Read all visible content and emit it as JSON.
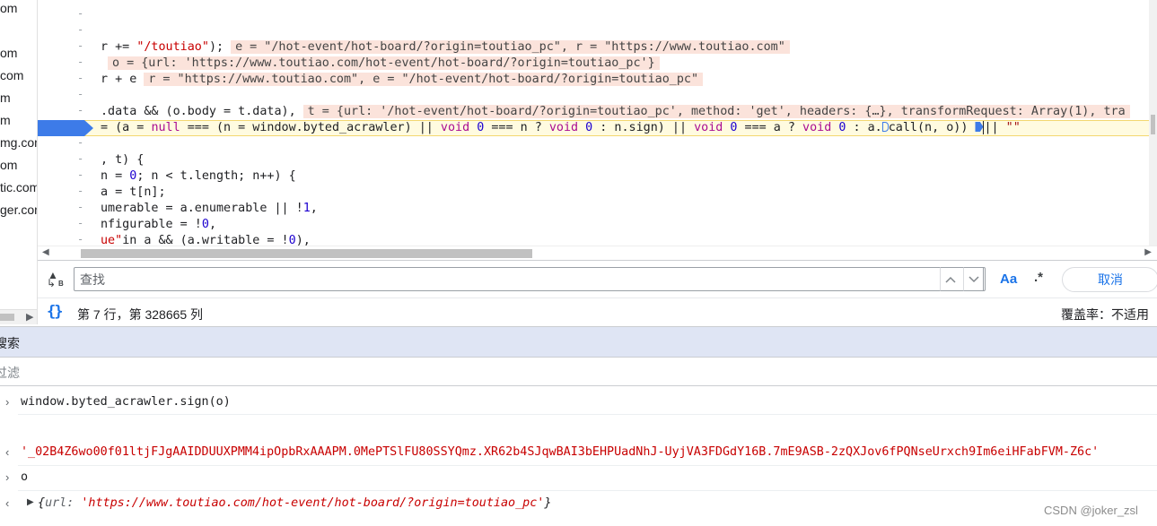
{
  "file_list": {
    "items": [
      {
        "text": "om"
      },
      {
        "text": "om"
      },
      {
        "text": "com"
      },
      {
        "text": "m"
      },
      {
        "text": "m"
      },
      {
        "text": "mg.con"
      },
      {
        "text": "om"
      },
      {
        "text": "tic.com"
      },
      {
        "text": "ger.con"
      }
    ]
  },
  "editor": {
    "lines": [
      {
        "segments": [
          [
            "",
            "r += "
          ],
          [
            "str",
            "\"/toutiao\""
          ],
          [
            "",
            ");"
          ]
        ],
        "inline": "e = \"/hot-event/hot-board/?origin=toutiao_pc\", r = \"https://www.toutiao.com\""
      },
      {
        "segments": [
          [
            "",
            ""
          ]
        ],
        "inline": "o = {url: 'https://www.toutiao.com/hot-event/hot-board/?origin=toutiao_pc'}"
      },
      {
        "segments": [
          [
            "",
            "r + e"
          ]
        ],
        "inline": "r = \"https://www.toutiao.com\", e = \"/hot-event/hot-board/?origin=toutiao_pc\""
      },
      {
        "segments": [
          [
            "",
            ".data && (o.body = t.data),"
          ]
        ],
        "inline": "t = {url: '/hot-event/hot-board/?origin=toutiao_pc', method: 'get', headers: {…}, transformRequest: Array(1), tra"
      },
      {
        "segments": [
          [
            "",
            "= (a = "
          ],
          [
            "kw",
            "null"
          ],
          [
            "",
            " === (n = window.byted_acrawler) || "
          ],
          [
            "kw",
            "void"
          ],
          [
            "",
            " "
          ],
          [
            "num",
            "0"
          ],
          [
            "",
            " === n ? "
          ],
          [
            "kw",
            "void"
          ],
          [
            "",
            " "
          ],
          [
            "num",
            "0"
          ],
          [
            "",
            " : n.sign) || "
          ],
          [
            "kw",
            "void"
          ],
          [
            "",
            " "
          ],
          [
            "num",
            "0"
          ],
          [
            "",
            " === a ? "
          ],
          [
            "kw",
            "void"
          ],
          [
            "",
            " "
          ],
          [
            "num",
            "0"
          ],
          [
            "",
            " : a."
          ]
        ],
        "after_marker": "call(n, o))",
        "trailing": "|| \"\""
      },
      {
        "segments": [
          [
            "",
            ", t) {"
          ]
        ]
      },
      {
        "segments": [
          [
            "",
            "n = "
          ],
          [
            "num",
            "0"
          ],
          [
            "",
            "; n < t.length; n++) {"
          ]
        ]
      },
      {
        "segments": [
          [
            "",
            "a = t[n];"
          ]
        ]
      },
      {
        "segments": [
          [
            "",
            "umerable = a.enumerable || !"
          ],
          [
            "num",
            "1"
          ],
          [
            "",
            ","
          ]
        ]
      },
      {
        "segments": [
          [
            "",
            "nfigurable = !"
          ],
          [
            "num",
            "0"
          ],
          [
            "",
            ","
          ]
        ]
      },
      {
        "segments": [
          [
            "str",
            "ue\""
          ],
          [
            "",
            "in a && (a.writable = !"
          ],
          [
            "num",
            "0"
          ],
          [
            "",
            "),"
          ]
        ]
      }
    ]
  },
  "search": {
    "placeholder": "查找",
    "match_case_label": "Aa",
    "regex_label": ".*",
    "cancel_label": "取消"
  },
  "status": {
    "cursor_position": "第 7 行，第 328665 列",
    "coverage": "覆盖率：不适用",
    "pretty_print_icon": "{}"
  },
  "drawer": {
    "active_tab": "搜索",
    "filter_placeholder": "过滤"
  },
  "console": {
    "input1": "window.byted_acrawler.sign(o)",
    "result1": "'_02B4Z6wo00f01ltjFJgAAIDDUUXPMM4ipOpbRxAAAPM.0MePTSlFU80SSYQmz.XR62b4SJqwBAI3bEHPUadNhJ-UyjVA3FDGdY16B.7mE9ASB-2zQXJov6fPQNseUrxch9Im6eiHFabFVM-Z6c'",
    "input2": "o",
    "result2": {
      "brace_open": "{",
      "key": "url:",
      "value": "'https://www.toutiao.com/hot-event/hot-board/?origin=toutiao_pc'",
      "brace_close": "}"
    }
  },
  "watermark": "CSDN @joker_zsl",
  "colors": {
    "accent": "#1a73e8",
    "exec_line": "#fffbe0",
    "breakpoint": "#3d7be8",
    "string": "#c80000",
    "inline_value_bg": "#fbe3db",
    "drawer_tab_bg": "#dfe5f4"
  }
}
